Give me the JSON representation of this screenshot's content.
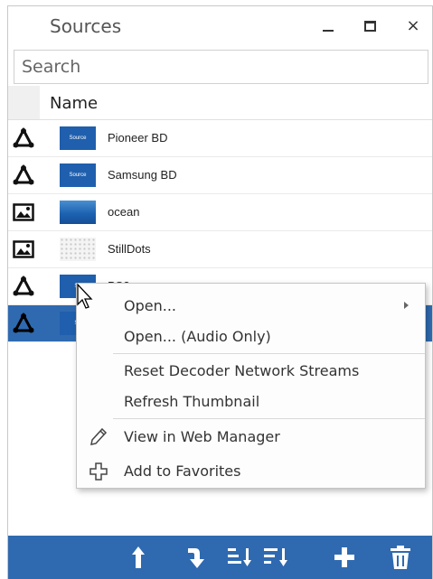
{
  "window": {
    "title": "Sources",
    "minimize_icon": "minimize-icon",
    "maximize_icon": "maximize-icon",
    "close_icon": "close-icon",
    "close_glyph": "×"
  },
  "search": {
    "placeholder": "Search",
    "value": ""
  },
  "table": {
    "column_header": "Name",
    "rows": [
      {
        "label": "Pioneer BD",
        "type_icon": "network-source-icon",
        "thumb": "source",
        "thumb_text": "Source"
      },
      {
        "label": "Samsung BD",
        "type_icon": "network-source-icon",
        "thumb": "source",
        "thumb_text": "Source"
      },
      {
        "label": "ocean",
        "type_icon": "image-icon",
        "thumb": "ocean"
      },
      {
        "label": "StillDots",
        "type_icon": "image-icon",
        "thumb": "dots"
      },
      {
        "label": "PS3",
        "type_icon": "network-source-icon",
        "thumb": "source",
        "thumb_text": "So"
      },
      {
        "label": "",
        "type_icon": "network-source-icon",
        "thumb": "source",
        "thumb_text": "So",
        "selected": true
      }
    ]
  },
  "context_menu": {
    "items": [
      {
        "label": "Open...",
        "has_submenu": true
      },
      {
        "label": "Open... (Audio Only)"
      },
      {
        "label": "Reset Decoder Network Streams"
      },
      {
        "label": "Refresh Thumbnail"
      },
      {
        "label": "View in Web Manager",
        "icon": "pencil-icon"
      },
      {
        "label": "Add to Favorites",
        "icon": "plus-outline-icon"
      }
    ]
  },
  "footer": {
    "buttons": [
      {
        "name": "upload-button",
        "icon": "up-arrow-icon"
      },
      {
        "name": "import-button",
        "icon": "turn-down-arrow-icon"
      },
      {
        "name": "sort-ascending-button",
        "icon": "sort-ascending-icon"
      },
      {
        "name": "sort-filter-button",
        "icon": "sort-filter-icon"
      },
      {
        "name": "add-button",
        "icon": "plus-icon"
      },
      {
        "name": "delete-button",
        "icon": "trash-icon"
      }
    ]
  },
  "colors": {
    "accent": "#2f6ab0",
    "thumb_source": "#1f5fad"
  }
}
